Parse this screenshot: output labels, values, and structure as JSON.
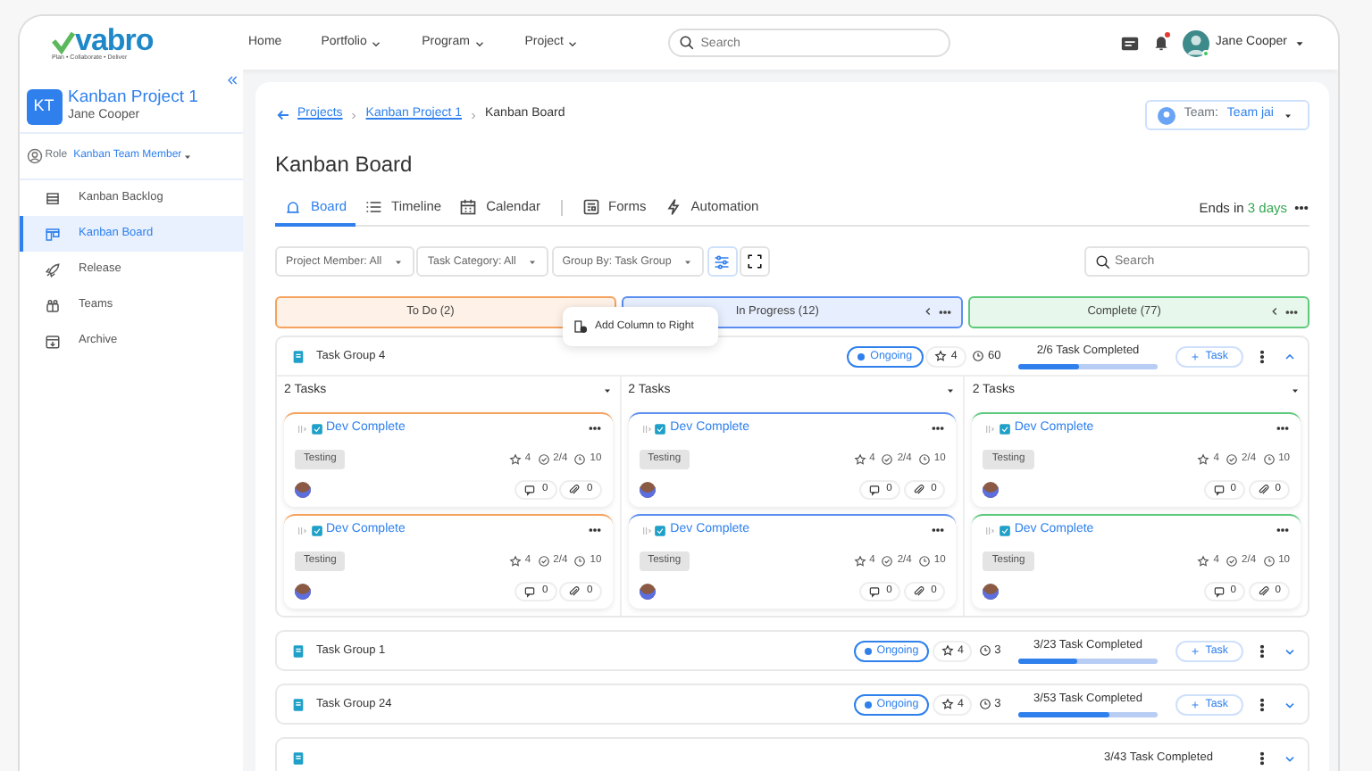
{
  "brand": {
    "name": "vabro",
    "tagline": "Plan • Collaborate • Deliver"
  },
  "nav": [
    {
      "label": "Home",
      "dropdown": false
    },
    {
      "label": "Portfolio",
      "dropdown": true
    },
    {
      "label": "Program",
      "dropdown": true
    },
    {
      "label": "Project",
      "dropdown": true
    }
  ],
  "search": {
    "placeholder": "Search"
  },
  "user": {
    "name": "Jane Cooper",
    "online": true,
    "notification": true
  },
  "project": {
    "initials": "KT",
    "name": "Kanban Project 1",
    "owner": "Jane Cooper"
  },
  "role": {
    "label": "Role",
    "value": "Kanban Team Member"
  },
  "sidebar": {
    "items": [
      {
        "label": "Kanban Backlog",
        "selected": false
      },
      {
        "label": "Kanban Board",
        "selected": true
      },
      {
        "label": "Release",
        "selected": false
      },
      {
        "label": "Teams",
        "selected": false
      },
      {
        "label": "Archive",
        "selected": false
      }
    ]
  },
  "breadcrumb": [
    "Projects",
    "Kanban Project 1",
    "Kanban Board"
  ],
  "team": {
    "label": "Team:",
    "value": "Team jai"
  },
  "title": "Kanban Board",
  "tabs": [
    {
      "label": "Board",
      "selected": true
    },
    {
      "label": "Timeline",
      "selected": false
    },
    {
      "label": "Calendar",
      "selected": false
    },
    {
      "label": "Forms",
      "selected": false
    },
    {
      "label": "Automation",
      "selected": false
    }
  ],
  "ends": {
    "text": "Ends in",
    "days": "3 days"
  },
  "filters": [
    {
      "label": "Project Member:",
      "value": "All"
    },
    {
      "label": "Task Category:",
      "value": "All"
    },
    {
      "label": "Group By:",
      "value": "Task Group"
    }
  ],
  "board_search": {
    "placeholder": "Search"
  },
  "columns": [
    {
      "title": "To Do (2)",
      "color": "#f5a25d"
    },
    {
      "title": "In Progress (12)",
      "color": "#5b8ef0"
    },
    {
      "title": "Complete (77)",
      "color": "#5cc97b"
    }
  ],
  "menu": {
    "items": [
      "Add Column to Right"
    ]
  },
  "groups": [
    {
      "name": "Task Group 4",
      "status": "Ongoing",
      "points": "4",
      "duration": "60",
      "progress": "2/6 Task Completed",
      "level": 0.43,
      "add": "Task",
      "expanded": true,
      "lanes": [
        {
          "count": "2 Tasks",
          "tasks": [
            {
              "title": "Dev Complete",
              "tag": "Testing",
              "points": "4",
              "checklist": "2/4",
              "hours": "10",
              "comments": "0",
              "attachments": "0"
            },
            {
              "title": "Dev Complete",
              "tag": "Testing",
              "points": "4",
              "checklist": "2/4",
              "hours": "10",
              "comments": "0",
              "attachments": "0"
            }
          ]
        },
        {
          "count": "2 Tasks",
          "tasks": [
            {
              "title": "Dev Complete",
              "tag": "Testing",
              "points": "4",
              "checklist": "2/4",
              "hours": "10",
              "comments": "0",
              "attachments": "0"
            },
            {
              "title": "Dev Complete",
              "tag": "Testing",
              "points": "4",
              "checklist": "2/4",
              "hours": "10",
              "comments": "0",
              "attachments": "0"
            }
          ]
        },
        {
          "count": "2 Tasks",
          "tasks": [
            {
              "title": "Dev Complete",
              "tag": "Testing",
              "points": "4",
              "checklist": "2/4",
              "hours": "10",
              "comments": "0",
              "attachments": "0"
            },
            {
              "title": "Dev Complete",
              "tag": "Testing",
              "points": "4",
              "checklist": "2/4",
              "hours": "10",
              "comments": "0",
              "attachments": "0"
            }
          ]
        }
      ]
    },
    {
      "name": "Task Group 1",
      "status": "Ongoing",
      "points": "4",
      "duration": "3",
      "progress": "3/23 Task Completed",
      "level": 0.42,
      "add": "Task",
      "expanded": false
    },
    {
      "name": "Task Group 24",
      "status": "Ongoing",
      "points": "4",
      "duration": "3",
      "progress": "3/53 Task Completed",
      "level": 0.66,
      "add": "Task",
      "expanded": false
    },
    {
      "progress": "3/43 Task Completed",
      "expanded": false
    }
  ]
}
